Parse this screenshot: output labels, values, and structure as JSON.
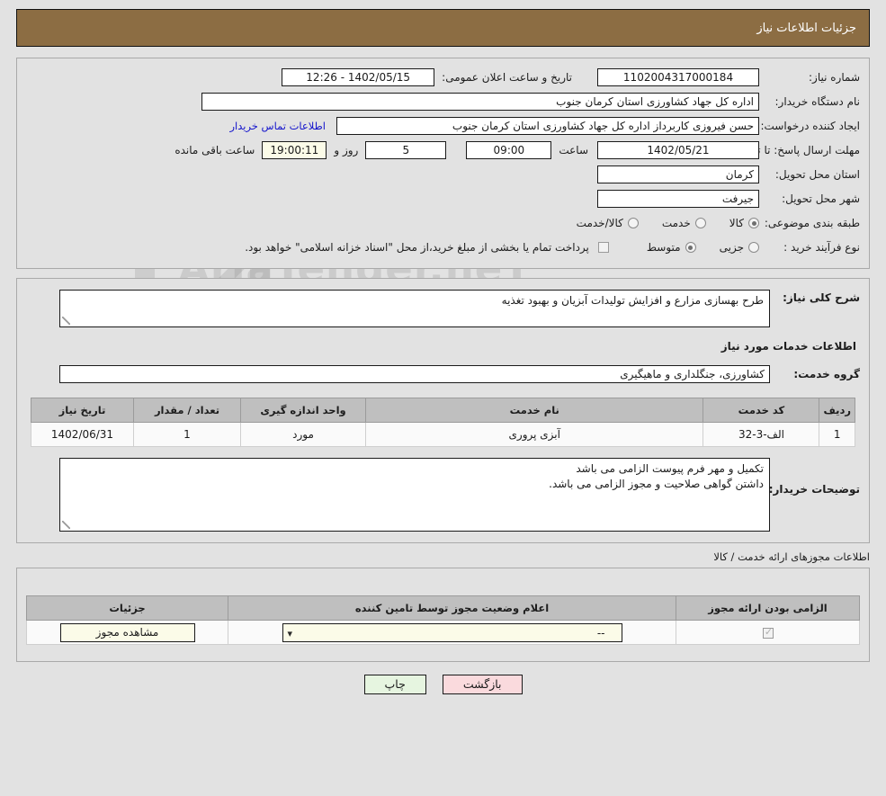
{
  "header": {
    "title": "جزئیات اطلاعات نیاز",
    "bg_color": "#8c6d43"
  },
  "summary": {
    "need_number_label": "شماره نیاز:",
    "need_number_value": "1102004317000184",
    "public_announce_label": "تاریخ و ساعت اعلان عمومی:",
    "public_announce_value": "1402/05/15 - 12:26",
    "buyer_org_label": "نام دستگاه خریدار:",
    "buyer_org_value": "اداره کل جهاد کشاورزی استان کرمان   جنوب",
    "requester_label": "ایجاد کننده درخواست:",
    "requester_value": "حسن فیروزی کاربرداز اداره کل جهاد کشاورزی استان کرمان   جنوب",
    "buyer_contact_link": "اطلاعات تماس خریدار",
    "deadline_label": "مهلت ارسال پاسخ: تا تاریخ:",
    "deadline_date": "1402/05/21",
    "deadline_time_label": "ساعت",
    "deadline_time": "09:00",
    "remaining_days": "5",
    "remaining_days_label": "روز و",
    "remaining_time": "19:00:11",
    "remaining_time_label": "ساعت باقی مانده",
    "province_label": "استان محل تحویل:",
    "province_value": "کرمان",
    "city_label": "شهر محل تحویل:",
    "city_value": "جیرفت",
    "category_label": "طبقه بندی موضوعی:",
    "category_options": [
      {
        "label": "کالا",
        "selected": true
      },
      {
        "label": "خدمت",
        "selected": false
      },
      {
        "label": "کالا/خدمت",
        "selected": false
      }
    ],
    "process_label": "نوع فرآیند خرید :",
    "process_options": [
      {
        "label": "جزیی",
        "selected": false
      },
      {
        "label": "متوسط",
        "selected": true
      }
    ],
    "treasury_checkbox_checked": false,
    "treasury_note": "پرداخت تمام یا بخشی از مبلغ خرید،از محل \"اسناد خزانه اسلامی\" خواهد بود."
  },
  "general": {
    "need_desc_label": "شرح کلی نیاز:",
    "need_desc_value": "طرح بهسازی مزارع و افزایش تولیدات آبزیان و بهبود تغذیه",
    "services_heading": "اطلاعات خدمات مورد نیاز",
    "service_group_label": "گروه خدمت:",
    "service_group_value": "کشاورزی، جنگلداری و ماهیگیری"
  },
  "items_table": {
    "columns": [
      "ردیف",
      "کد خدمت",
      "نام خدمت",
      "واحد اندازه گیری",
      "تعداد / مقدار",
      "تاریخ نیاز"
    ],
    "rows": [
      {
        "radif": "1",
        "code": "الف-3-32",
        "name": "آبزی پروری",
        "unit": "مورد",
        "qty": "1",
        "date": "1402/06/31"
      }
    ]
  },
  "buyer_notes": {
    "label": "توضیحات خریدار:",
    "lines": [
      "تکمیل و مهر فرم پیوست الزامی می باشد",
      "داشتن گواهی صلاحیت و مجوز الزامی می باشد."
    ]
  },
  "permits": {
    "section_title": "اطلاعات مجوزهای ارائه خدمت / کالا",
    "columns": [
      "الزامی بودن ارائه مجوز",
      "اعلام وضعیت مجوز توسط تامین کننده",
      "جزئیات"
    ],
    "rows": [
      {
        "required_checked": true,
        "status_value": "--",
        "details_button": "مشاهده مجوز"
      }
    ]
  },
  "footer": {
    "print_label": "چاپ",
    "back_label": "بازگشت"
  }
}
